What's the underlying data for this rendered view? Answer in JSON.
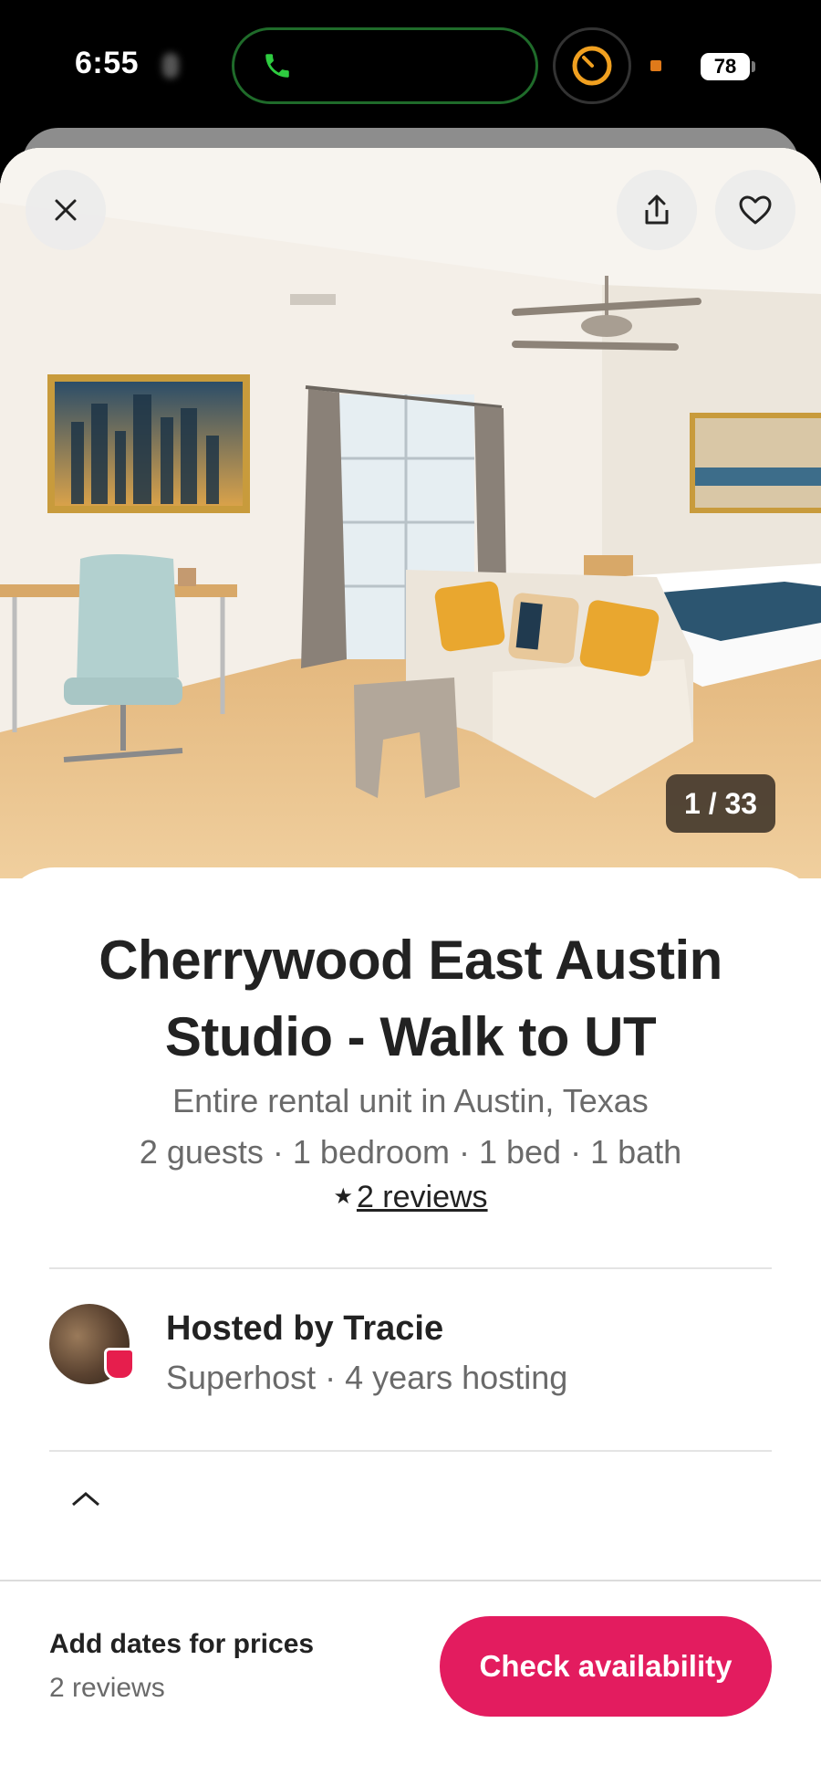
{
  "status_bar": {
    "time": "6:55",
    "battery": "78"
  },
  "photo": {
    "counter": "1 / 33"
  },
  "listing": {
    "title": "Cherrywood East Austin Studio - Walk to UT",
    "subtitle_line1": "Entire rental unit in Austin, Texas",
    "subtitle_line2": "2 guests · 1 bedroom · 1 bed · 1 bath",
    "reviews_link": "2 reviews"
  },
  "host": {
    "name": "Hosted by Tracie",
    "meta": "Superhost · 4 years hosting"
  },
  "bottom_bar": {
    "price_label": "Add dates for prices",
    "reviews": "2 reviews",
    "cta_label": "Check availability"
  },
  "colors": {
    "accent": "#e31c5f",
    "call_green": "#2ecc40",
    "timer_orange": "#f0a020"
  },
  "icons": [
    "phone-icon",
    "timer-icon",
    "close-icon",
    "share-icon",
    "heart-icon",
    "star-icon",
    "superhost-badge-icon",
    "house-icon"
  ]
}
